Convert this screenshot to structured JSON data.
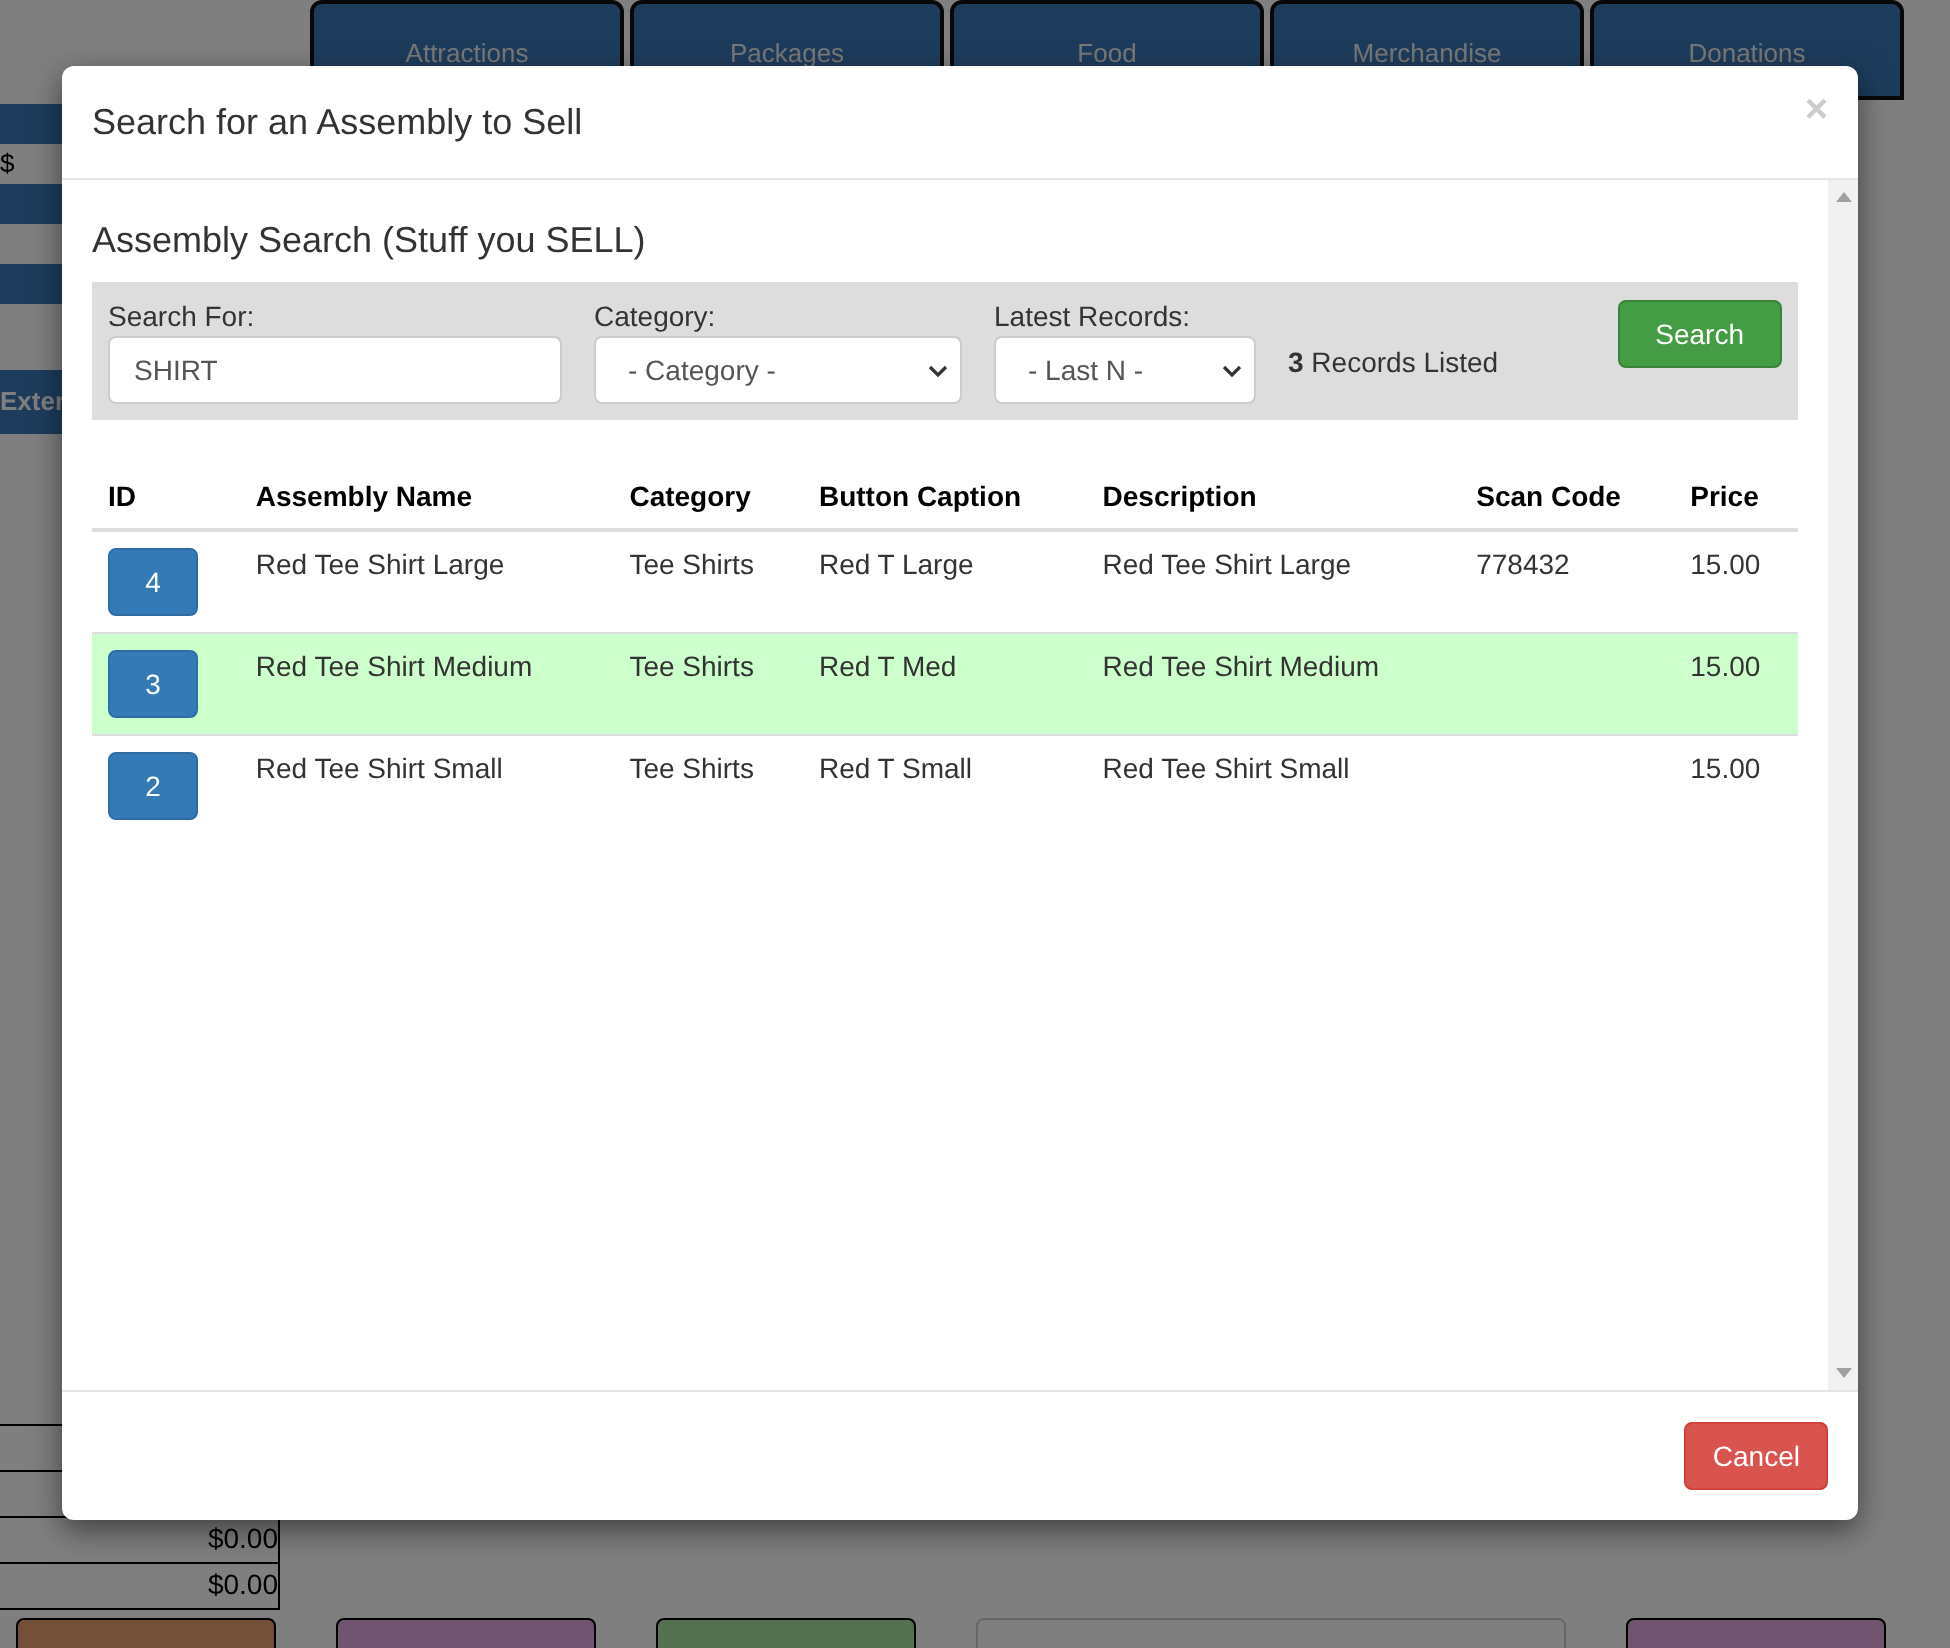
{
  "background": {
    "tabs": [
      "Attractions",
      "Packages",
      "Food",
      "Merchandise",
      "Donations"
    ],
    "side_labels": [
      "$",
      "Exter"
    ],
    "totals": [
      "$0.00",
      "$0.00"
    ]
  },
  "modal": {
    "title": "Search for an Assembly to Sell",
    "close": "×",
    "heading": "Assembly Search (Stuff you SELL)",
    "search_label": "Search For:",
    "search_value": "SHIRT",
    "category_label": "Category:",
    "category_value": "- Category -",
    "latest_label": "Latest Records:",
    "latest_value": "- Last N -",
    "records_count": "3",
    "records_text": "Records Listed",
    "search_button": "Search",
    "columns": [
      "ID",
      "Assembly Name",
      "Category",
      "Button Caption",
      "Description",
      "Scan Code",
      "Price"
    ],
    "rows": [
      {
        "id": "4",
        "name": "Red Tee Shirt Large",
        "category": "Tee Shirts",
        "caption": "Red T Large",
        "description": "Red Tee Shirt Large",
        "scan_code": "778432",
        "price": "15.00",
        "selected": false
      },
      {
        "id": "3",
        "name": "Red Tee Shirt Medium",
        "category": "Tee Shirts",
        "caption": "Red T Med",
        "description": "Red Tee Shirt Medium",
        "scan_code": "",
        "price": "15.00",
        "selected": true
      },
      {
        "id": "2",
        "name": "Red Tee Shirt Small",
        "category": "Tee Shirts",
        "caption": "Red T Small",
        "description": "Red Tee Shirt Small",
        "scan_code": "",
        "price": "15.00",
        "selected": false
      }
    ],
    "cancel_button": "Cancel"
  }
}
